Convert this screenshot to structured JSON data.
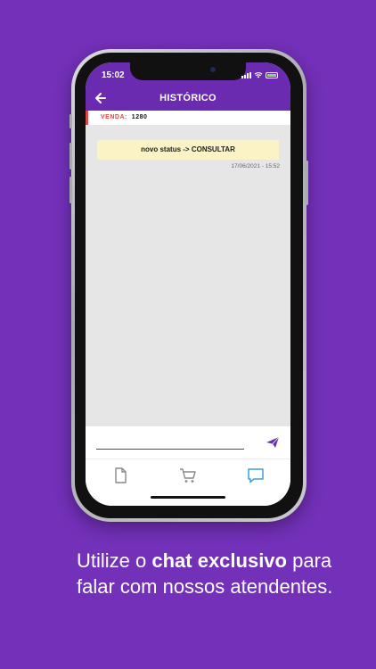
{
  "status_bar": {
    "time": "15:02"
  },
  "header": {
    "title": "HISTÓRICO"
  },
  "sale": {
    "label": "VENDA:",
    "number": "1280"
  },
  "messages": [
    {
      "text": "novo status -> CONSULTAR",
      "timestamp": "17/06/2021 - 15:52"
    }
  ],
  "composer": {
    "value": "",
    "placeholder": ""
  },
  "tabs": [
    {
      "name": "documents",
      "icon": "document-icon",
      "active": false
    },
    {
      "name": "cart",
      "icon": "cart-icon",
      "active": false
    },
    {
      "name": "chat",
      "icon": "chat-icon",
      "active": true
    }
  ],
  "caption": {
    "prefix": "Utilize o ",
    "bold": "chat exclusivo",
    "suffix": " para falar com nossos atendentes."
  },
  "colors": {
    "background": "#7330b9",
    "header": "#6a2bb0",
    "venda_accent": "#e04848",
    "active_tab": "#3aa0dc",
    "bubble": "#fbf2c6"
  }
}
